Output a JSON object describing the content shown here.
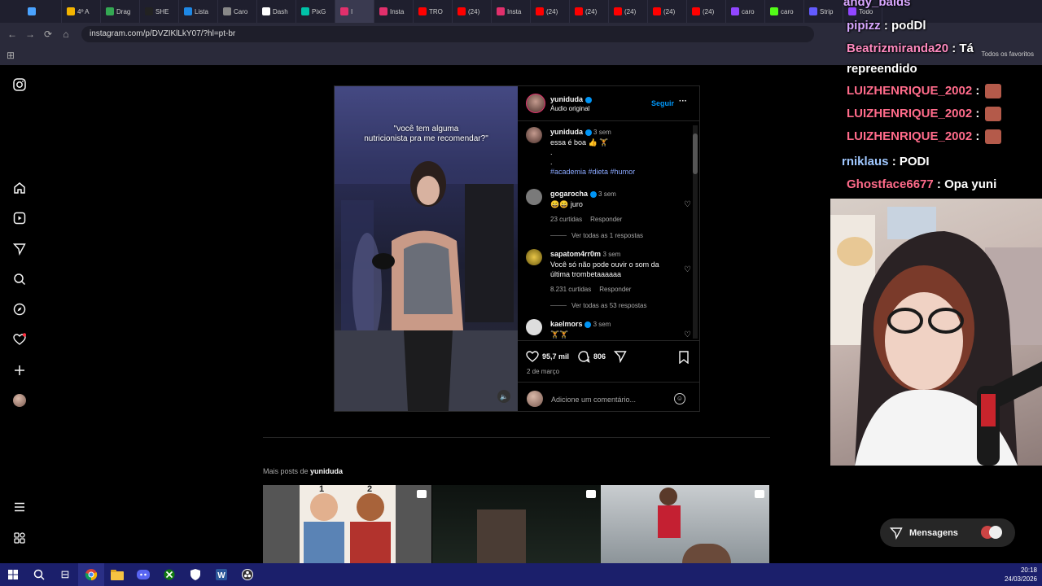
{
  "browser": {
    "tabs": [
      {
        "label": "",
        "color": "#4aa3ff"
      },
      {
        "label": "4º A",
        "color": "#f4b400"
      },
      {
        "label": "Drag",
        "color": "#34a853"
      },
      {
        "label": "SHE",
        "color": "#222222"
      },
      {
        "label": "Lista",
        "color": "#1e88e5"
      },
      {
        "label": "Caro",
        "color": "#888888"
      },
      {
        "label": "Dash",
        "color": "#ffffff"
      },
      {
        "label": "PixG",
        "color": "#00c2a8"
      },
      {
        "label": "I",
        "color": "#e1306c"
      },
      {
        "label": "Insta",
        "color": "#e1306c"
      },
      {
        "label": "TRO",
        "color": "#ff0000"
      },
      {
        "label": "(24)",
        "color": "#ff0000"
      },
      {
        "label": "Insta",
        "color": "#e1306c"
      },
      {
        "label": "(24)",
        "color": "#ff0000"
      },
      {
        "label": "(24)",
        "color": "#ff0000"
      },
      {
        "label": "(24)",
        "color": "#ff0000"
      },
      {
        "label": "(24)",
        "color": "#ff0000"
      },
      {
        "label": "(24)",
        "color": "#ff0000"
      },
      {
        "label": "caro",
        "color": "#9146ff"
      },
      {
        "label": "caro",
        "color": "#53fc18"
      },
      {
        "label": "Strip",
        "color": "#635bff"
      },
      {
        "label": "Todo",
        "color": "#9146ff"
      }
    ],
    "active_tab_index": 8,
    "url": "instagram.com/p/DVZIKlLkY07/?hl=pt-br",
    "favorites_label": "Todos os favoritos"
  },
  "sidebar": {
    "icons": [
      "instagram-logo-icon",
      "home-icon",
      "reels-icon",
      "send-icon",
      "search-icon",
      "explore-icon",
      "notifications-icon",
      "create-icon",
      "profile-icon",
      "menu-icon",
      "apps-icon"
    ]
  },
  "post": {
    "overlay_text_line1": "\"você tem alguma",
    "overlay_text_line2": "nutricionista pra me recomendar?\"",
    "author": "yuniduda",
    "audio": "Áudio original",
    "follow_label": "Seguir",
    "more_label": "···",
    "caption": {
      "user": "yuniduda",
      "time": "3 sem",
      "text": "essa é boa 👍 🏋",
      "dot1": ".",
      "dot2": ".",
      "hashtags": "#academia #dieta #humor"
    },
    "comments": [
      {
        "user": "gogarocha",
        "time": "3 sem",
        "text": "😄😄 juro",
        "likes": "23 curtidas",
        "reply": "Responder",
        "view_all": "Ver todas as 1 respostas"
      },
      {
        "user": "sapatom4rr0m",
        "time": "3 sem",
        "text_line1": "Você só não pode ouvir o som da",
        "text_line2": "última trombetaaaaaa",
        "likes": "8.231 curtidas",
        "reply": "Responder",
        "view_all": "Ver todas as 53 respostas"
      },
      {
        "user": "kaelmors",
        "time": "3 sem",
        "text": "🏋🏋"
      }
    ],
    "like_count": "95,7 mil",
    "comment_count": "806",
    "date": "2 de março",
    "add_comment_placeholder": "Adicione um comentário..."
  },
  "more_posts": {
    "label_prefix": "Mais posts de",
    "user": "yuniduda",
    "thumb1_label1": "1",
    "thumb1_label2": "2"
  },
  "messages_label": "Mensagens",
  "stream_chat": [
    {
      "user": "andy_balds",
      "text": "",
      "color": "#d9a7ff"
    },
    {
      "user": "pipizz",
      "text": " : podDl",
      "color": "#d9a7ff"
    },
    {
      "user": "Beatrizmiranda20",
      "text": " : Tá",
      "color": "#ff8ac0"
    },
    {
      "user": "",
      "text": "repreendido",
      "color": "#ffffff"
    },
    {
      "user": "LUIZHENRIQUE_2002",
      "text": " : ",
      "color": "#ff6b8a"
    },
    {
      "user": "LUIZHENRIQUE_2002",
      "text": " : ",
      "color": "#ff6b8a"
    },
    {
      "user": "LUIZHENRIQUE_2002",
      "text": " : ",
      "color": "#ff6b8a"
    },
    {
      "user": "rniklaus",
      "text": " : PODI",
      "color": "#a0c8ff"
    },
    {
      "user": "Ghostface6677",
      "text": " : Opa yuni",
      "color": "#ff6b8a"
    }
  ],
  "taskbar": {
    "time": "20:18",
    "date": "24/03/2026"
  }
}
